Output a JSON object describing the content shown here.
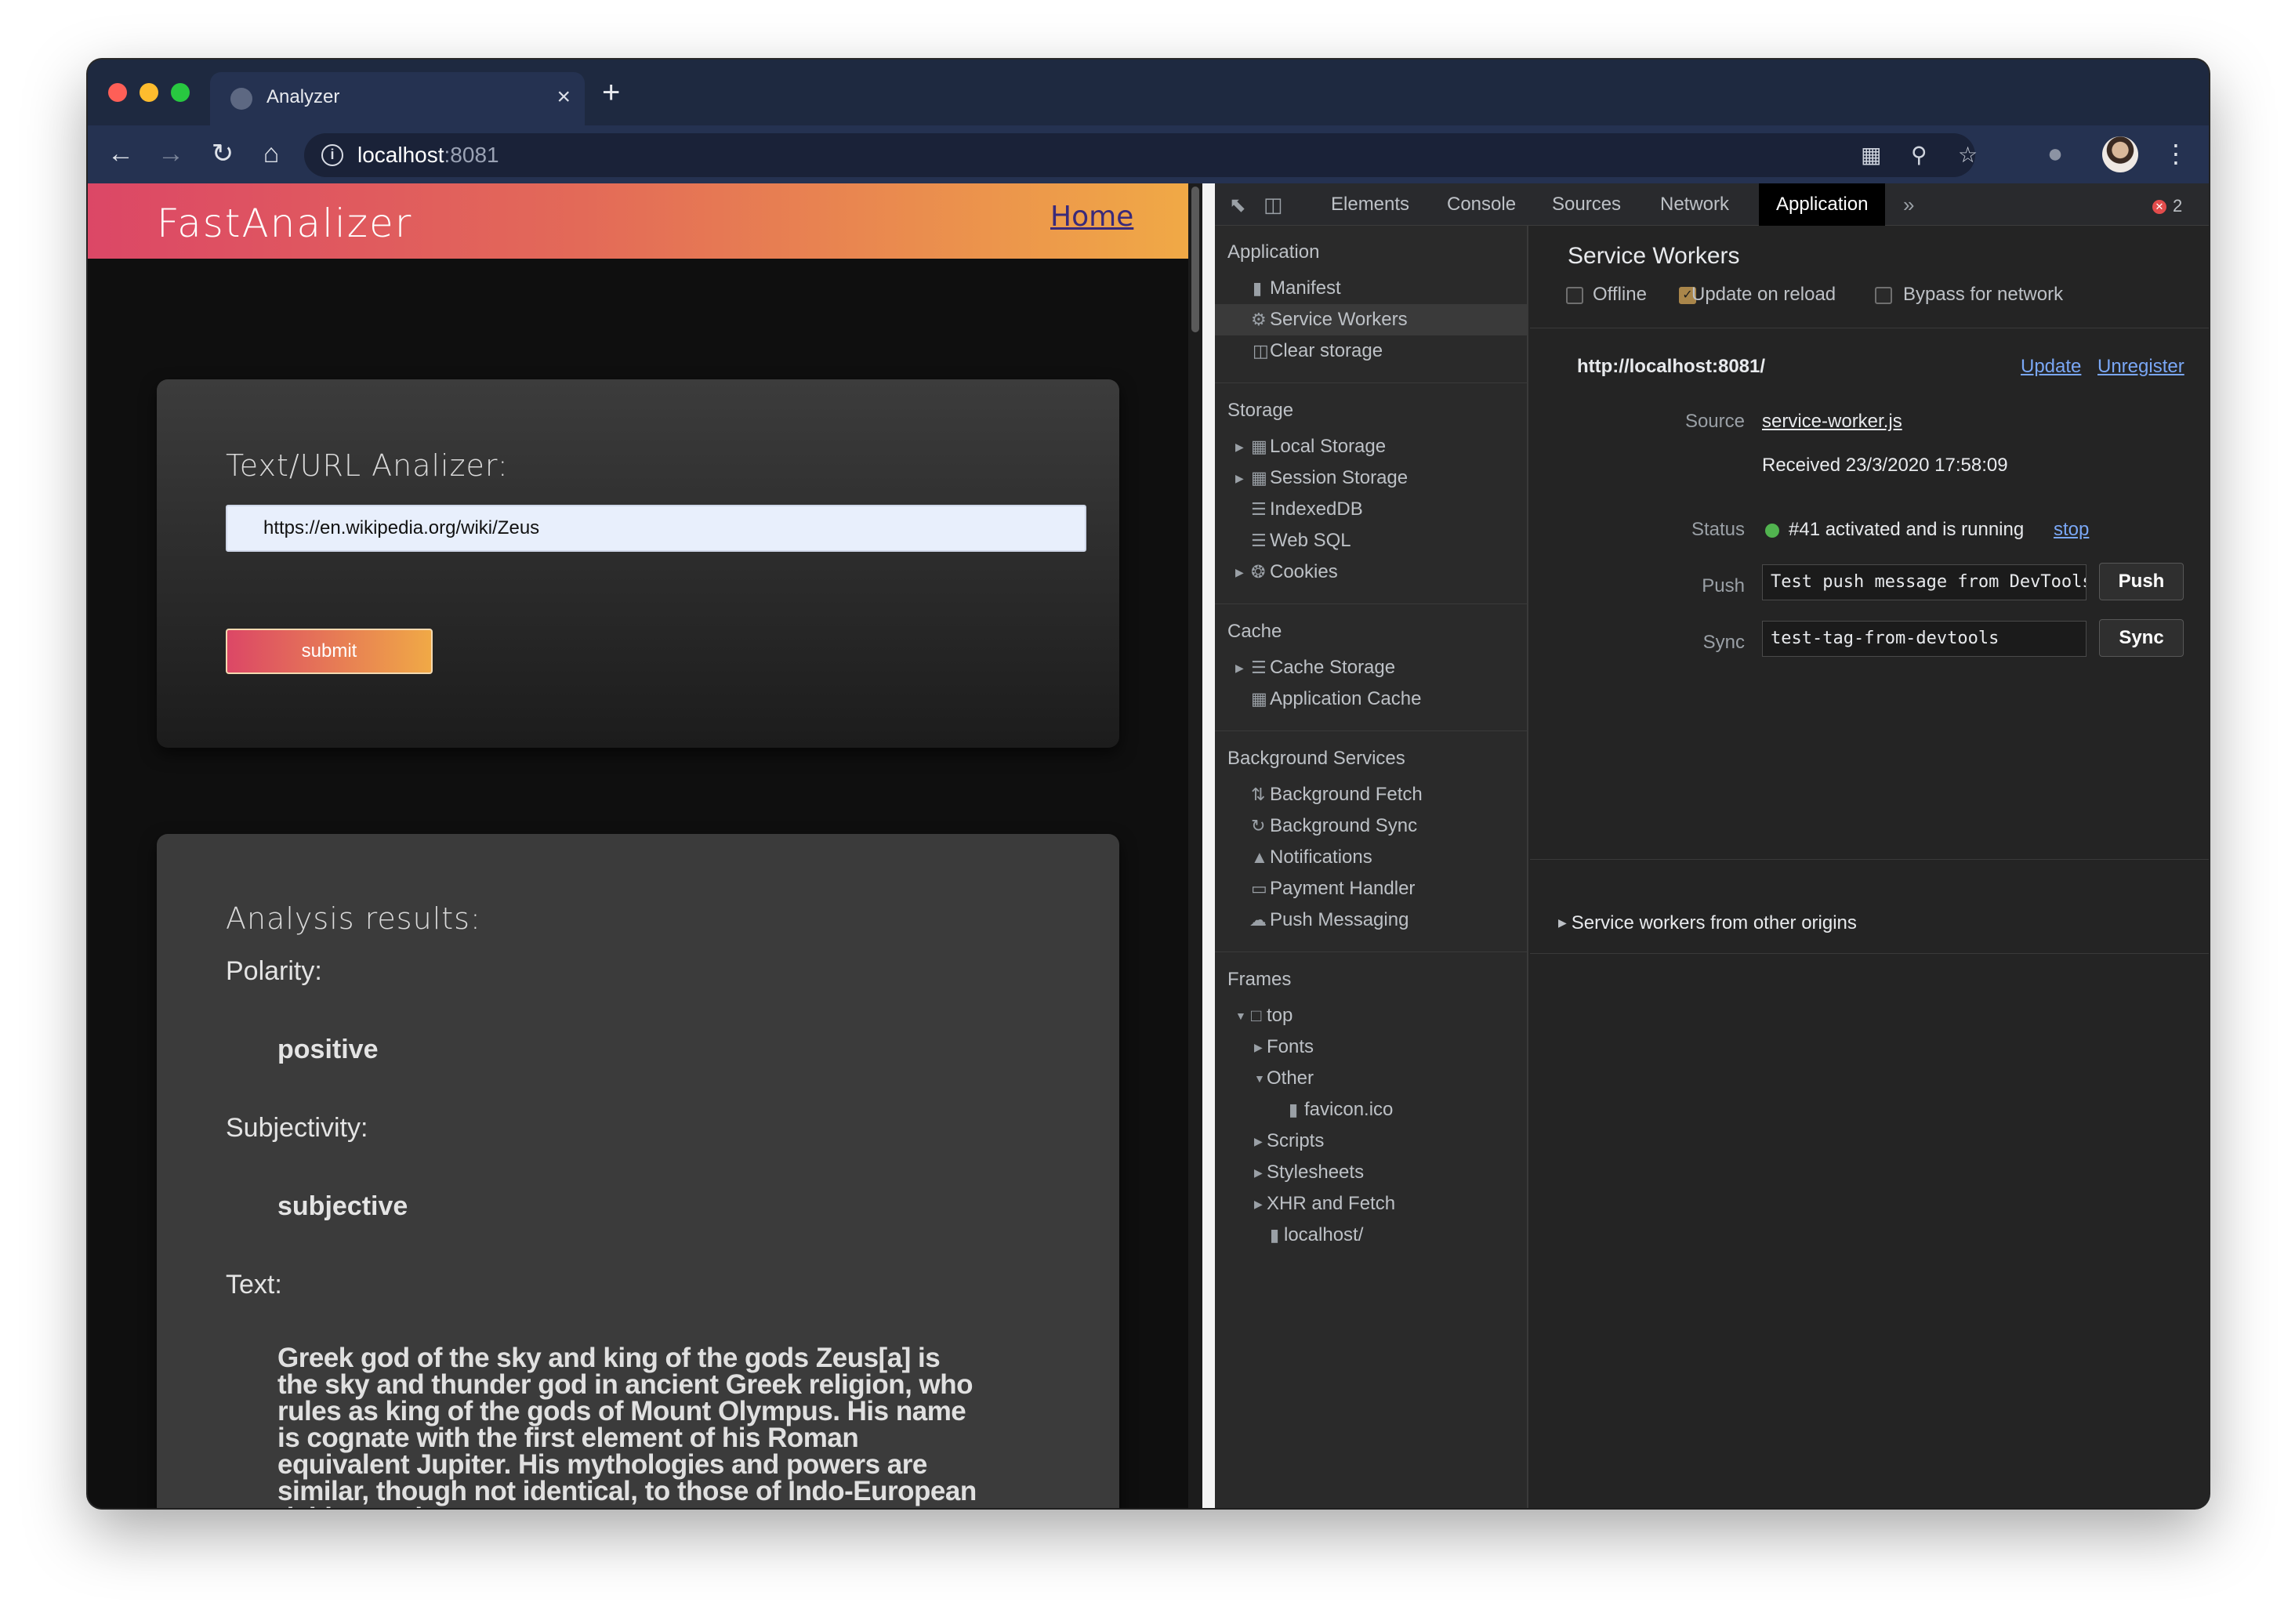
{
  "browser": {
    "tab_title": "Analyzer",
    "tab_close": "×",
    "new_tab": "+",
    "url_host": "localhost",
    "url_port": ":8081"
  },
  "site": {
    "logo": "FastAnalizer",
    "home_link": "Home",
    "analyzer_title": "Text/URL Analizer:",
    "input_value": "https://en.wikipedia.org/wiki/Zeus",
    "submit_label": "submit",
    "results_title": "Analysis results:",
    "polarity_label": "Polarity:",
    "polarity_value": "positive",
    "subjectivity_label": "Subjectivity:",
    "subjectivity_value": "subjective",
    "text_label": "Text:",
    "text_value": "Greek god of the sky and king of the gods Zeus[a] is the sky and thunder god in ancient Greek religion, who rules as king of the gods of Mount Olympus. His name is cognate with the first element of his Roman equivalent Jupiter. His mythologies and powers are similar, though not identical, to those of Indo-European deities such as"
  },
  "devtools": {
    "tabs": [
      "Elements",
      "Console",
      "Sources",
      "Network",
      "Application"
    ],
    "active_tab": "Application",
    "more_tabs": "»",
    "error_count": "2",
    "sidebar": {
      "application_head": "Application",
      "application_items": [
        "Manifest",
        "Service Workers",
        "Clear storage"
      ],
      "storage_head": "Storage",
      "storage_items": [
        "Local Storage",
        "Session Storage",
        "IndexedDB",
        "Web SQL",
        "Cookies"
      ],
      "cache_head": "Cache",
      "cache_items": [
        "Cache Storage",
        "Application Cache"
      ],
      "bg_head": "Background Services",
      "bg_items": [
        "Background Fetch",
        "Background Sync",
        "Notifications",
        "Payment Handler",
        "Push Messaging"
      ],
      "frames_head": "Frames",
      "frames_items": [
        "top",
        "Fonts",
        "Other",
        "favicon.ico",
        "Scripts",
        "Stylesheets",
        "XHR and Fetch",
        "localhost/"
      ]
    },
    "main": {
      "title": "Service Workers",
      "offline_label": "Offline",
      "update_on_reload_label": "Update on reload",
      "bypass_label": "Bypass for network",
      "offline_checked": false,
      "update_on_reload_checked": true,
      "bypass_checked": false,
      "origin": "http://localhost:8081/",
      "update_link": "Update",
      "unregister_link": "Unregister",
      "source_key": "Source",
      "source_value": "service-worker.js",
      "received": "Received 23/3/2020 17:58:09",
      "status_key": "Status",
      "status_value": "#41 activated and is running",
      "stop_link": "stop",
      "push_key": "Push",
      "push_value": "Test push message from DevTools.",
      "push_button": "Push",
      "sync_key": "Sync",
      "sync_value": "test-tag-from-devtools",
      "sync_button": "Sync",
      "other_origins": "Service workers from other origins"
    }
  },
  "colors": {
    "brand_gradient_start": "#dc4766",
    "brand_gradient_end": "#f0a946",
    "status_running": "#51b34f",
    "devtools_link": "#7aa7f5"
  }
}
